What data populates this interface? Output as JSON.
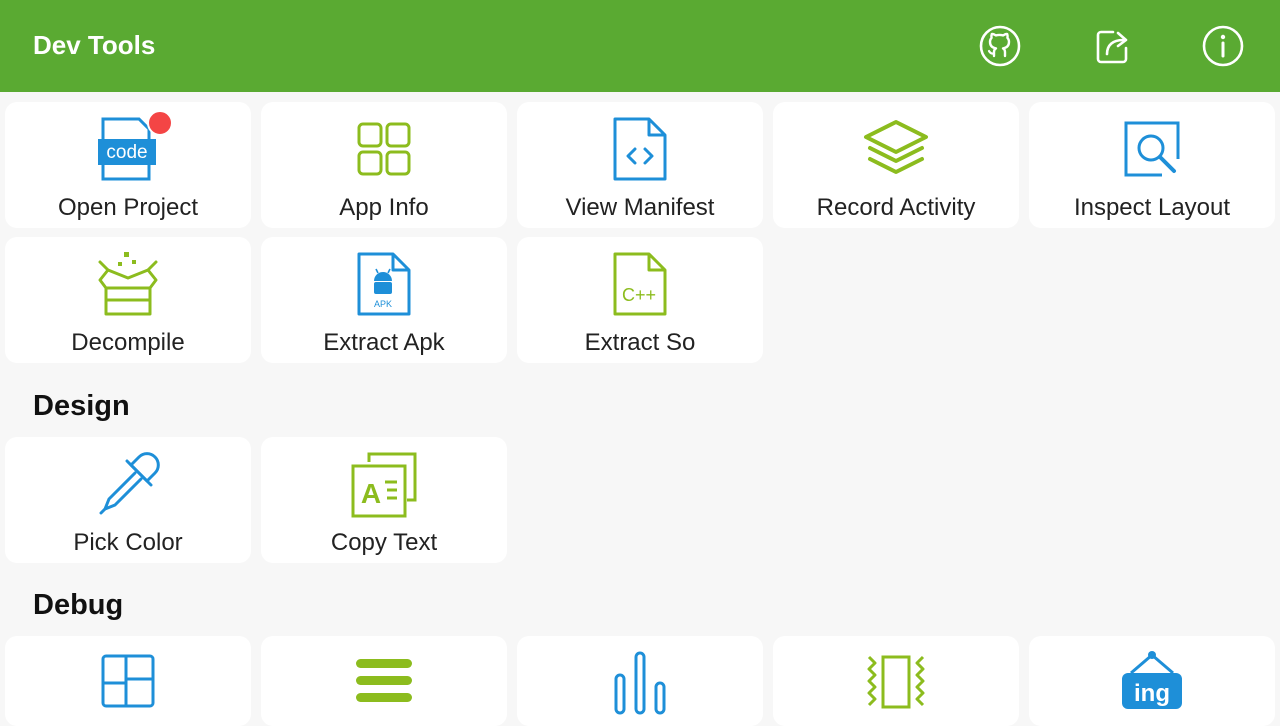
{
  "appbar": {
    "title": "Dev Tools",
    "actions": [
      {
        "name": "github-icon"
      },
      {
        "name": "share-icon"
      },
      {
        "name": "info-icon"
      }
    ]
  },
  "colors": {
    "appbar": "#5aaa32",
    "blue": "#1e8fd8",
    "green": "#8cbc1e",
    "badge": "#f44545"
  },
  "tools": {
    "open_project": "Open Project",
    "open_project_icon_text": "code",
    "app_info": "App Info",
    "view_manifest": "View Manifest",
    "record_activity": "Record Activity",
    "inspect_layout": "Inspect Layout",
    "decompile": "Decompile",
    "extract_apk": "Extract Apk",
    "extract_apk_icon_text": "APK",
    "extract_so": "Extract So",
    "extract_so_icon_text": "C++"
  },
  "design": {
    "heading": "Design",
    "pick_color": "Pick Color",
    "copy_text": "Copy Text",
    "copy_text_icon_text": "A"
  },
  "debug": {
    "heading": "Debug",
    "badge_text": "ing"
  }
}
